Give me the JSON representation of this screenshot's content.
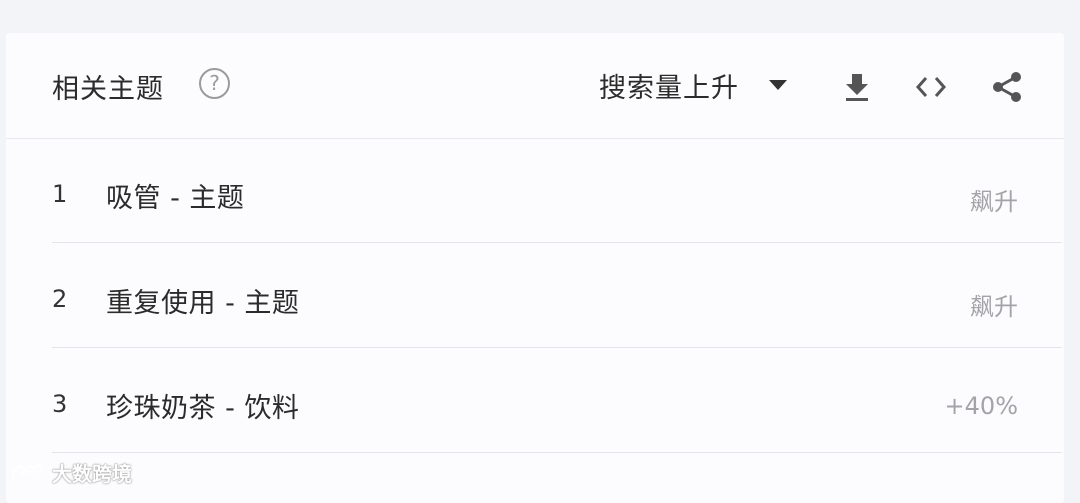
{
  "panel": {
    "title": "相关主题",
    "help_icon": "help-icon",
    "sort": {
      "selected": "搜索量上升"
    },
    "icons": [
      "download-icon",
      "embed-code-icon",
      "share-icon"
    ]
  },
  "rows": [
    {
      "rank": "1",
      "term": "吸管 - 主题",
      "value": "飙升"
    },
    {
      "rank": "2",
      "term": "重复使用 - 主题",
      "value": "飙升"
    },
    {
      "rank": "3",
      "term": "珍珠奶茶 - 饮料",
      "value": "+40%"
    }
  ],
  "watermark": {
    "text": "大数跨境"
  }
}
